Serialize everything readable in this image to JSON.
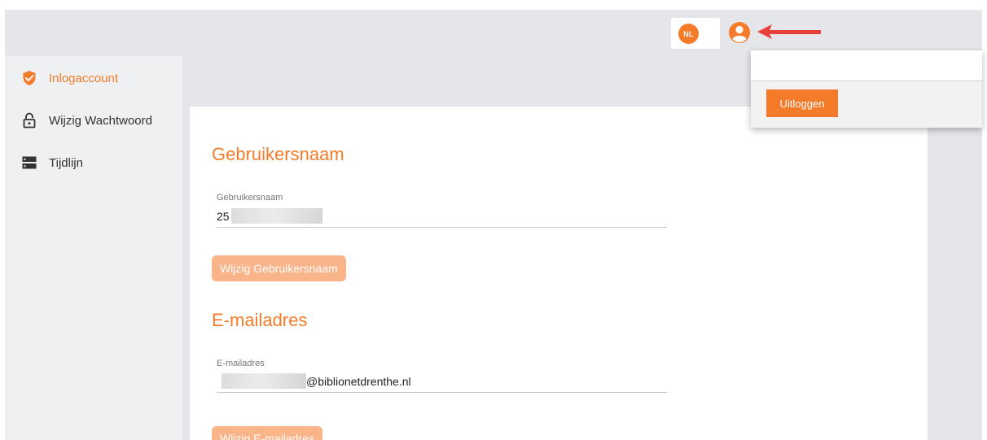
{
  "header": {
    "language_badge": "NL",
    "user_icon": "user-circle-icon"
  },
  "sidebar": {
    "items": [
      {
        "label": "Inlogaccount",
        "icon": "shield-check-icon",
        "active": true
      },
      {
        "label": "Wijzig Wachtwoord",
        "icon": "lock-icon",
        "active": false
      },
      {
        "label": "Tijdlijn",
        "icon": "server-icon",
        "active": false
      }
    ]
  },
  "main": {
    "username_section": {
      "title": "Gebruikersnaam",
      "field_label": "Gebruikersnaam",
      "field_value": "25",
      "button_label": "Wijzig Gebruikersnaam"
    },
    "email_section": {
      "title": "E-mailadres",
      "field_label": "E-mailadres",
      "field_value": "@biblionetdrenthe.nl",
      "button_label": "Wijzig E-mailadres"
    }
  },
  "user_menu": {
    "logout_label": "Uitloggen"
  },
  "colors": {
    "accent": "#f47b2a",
    "accent_light": "#f9b48a",
    "background": "#e4e6e9",
    "sidebar": "#eef0f2",
    "annotation_arrow": "#e8413c"
  }
}
